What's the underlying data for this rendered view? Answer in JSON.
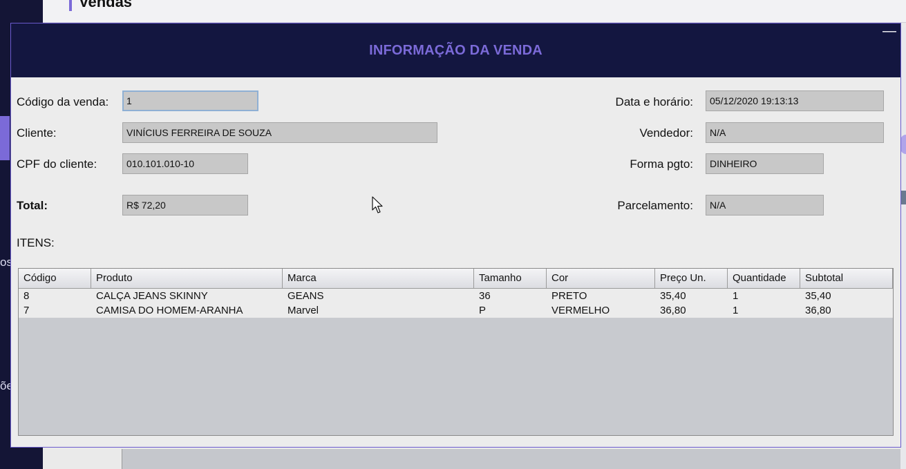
{
  "background": {
    "page_title": "Vendas",
    "sidebar_fragments": [
      "os",
      "õe"
    ]
  },
  "dialog": {
    "title": "INFORMAÇÃO DA VENDA",
    "minimize_glyph": "—",
    "fields": {
      "codigo_label": "Código da venda:",
      "codigo_value": "1",
      "cliente_label": "Cliente:",
      "cliente_value": "VINÍCIUS FERREIRA DE SOUZA",
      "cpf_label": "CPF do cliente:",
      "cpf_value": "010.101.010-10",
      "total_label": "Total:",
      "total_value": "R$ 72,20",
      "data_label": "Data e horário:",
      "data_value": "05/12/2020 19:13:13",
      "vendedor_label": "Vendedor:",
      "vendedor_value": "N/A",
      "forma_label": "Forma pgto:",
      "forma_value": "DINHEIRO",
      "parcelamento_label": "Parcelamento:",
      "parcelamento_value": "N/A"
    },
    "itens_label": "ITENS:",
    "table": {
      "columns": [
        "Código",
        "Produto",
        "Marca",
        "Tamanho",
        "Cor",
        "Preço Un.",
        "Quantidade",
        "Subtotal"
      ],
      "rows": [
        [
          "8",
          "CALÇA JEANS SKINNY",
          "GEANS",
          "36",
          "PRETO",
          "35,40",
          "1",
          "35,40"
        ],
        [
          "7",
          "CAMISA DO HOMEM-ARANHA",
          "Marvel",
          "P",
          "VERMELHO",
          "36,80",
          "1",
          "36,80"
        ]
      ]
    }
  },
  "colors": {
    "header_bg": "#131640",
    "accent": "#7b6ad8",
    "field_bg": "#c8c8c8"
  }
}
